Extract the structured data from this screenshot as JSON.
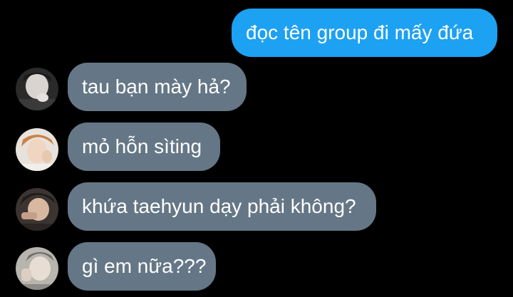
{
  "colors": {
    "background": "#000000",
    "outgoing_bubble": "#1da1f2",
    "incoming_bubble": "#657786",
    "text": "#ffffff"
  },
  "messages": [
    {
      "direction": "outgoing",
      "text": "đọc tên group đi mấy đứa"
    },
    {
      "direction": "incoming",
      "avatar": "user-avatar-1",
      "text": "tau bạn mày hả?"
    },
    {
      "direction": "incoming",
      "avatar": "user-avatar-2",
      "text": "mỏ hỗn sìting"
    },
    {
      "direction": "incoming",
      "avatar": "user-avatar-3",
      "text": "khứa taehyun dạy phải không?"
    },
    {
      "direction": "incoming",
      "avatar": "user-avatar-4",
      "text": "gì em nữa???"
    }
  ]
}
